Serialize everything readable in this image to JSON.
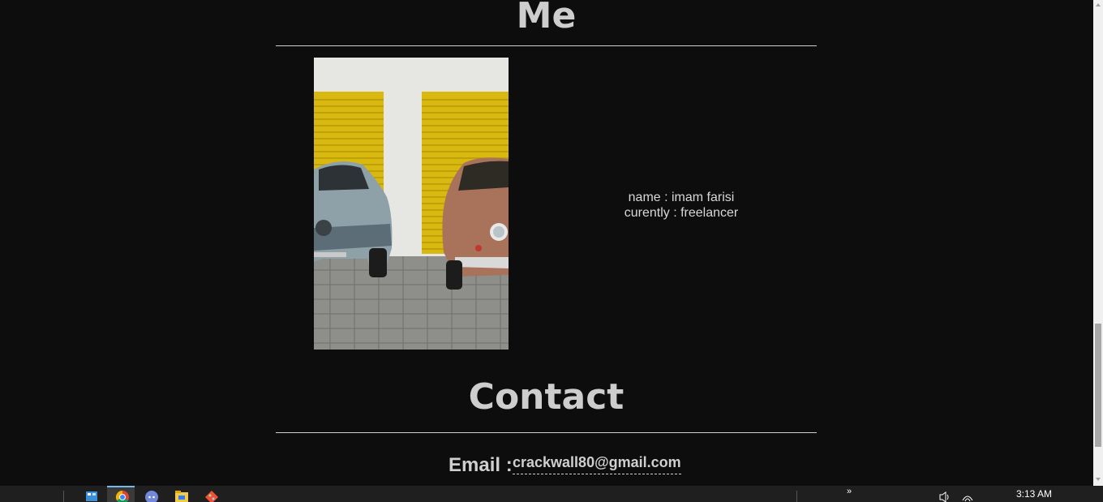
{
  "me": {
    "title": "Me",
    "photo_alt": "two classic cars in front of yellow garage doors",
    "name_line": "name : imam farisi",
    "status_line": "curently : freelancer"
  },
  "contact": {
    "title": "Contact",
    "email_label": "Email :",
    "email_value": "crackwall80@gmail.com"
  },
  "scrollbar": {
    "position": 0.73
  },
  "taskbar": {
    "icons": [
      "control-panel-icon",
      "chrome-icon",
      "discord-icon",
      "file-explorer-icon",
      "git-icon"
    ],
    "overflow_chevron": "»",
    "tray_icons": [
      "volume-icon",
      "wifi-icon"
    ],
    "clock": "3:13 AM"
  },
  "colors": {
    "background": "#0d0d0e",
    "text": "#cfcfcf",
    "garage_yellow": "#e8c619"
  }
}
